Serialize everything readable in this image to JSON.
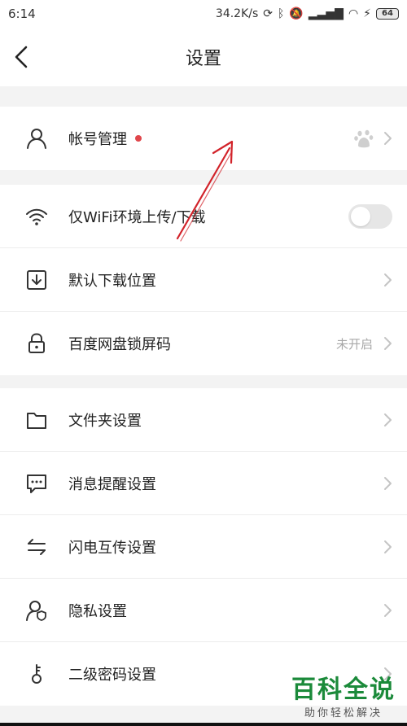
{
  "status_bar": {
    "time": "6:14",
    "net_speed": "34.2K/s",
    "battery": "64"
  },
  "header": {
    "title": "设置"
  },
  "sections": [
    {
      "rows": [
        {
          "label": "帐号管理",
          "icon": "user-icon",
          "badge_dot": true,
          "trailing": "baidu-icon"
        }
      ]
    },
    {
      "rows": [
        {
          "label": "仅WiFi环境上传/下载",
          "icon": "wifi-icon",
          "toggle_on": false
        },
        {
          "label": "默认下载位置",
          "icon": "download-icon"
        },
        {
          "label": "百度网盘锁屏码",
          "icon": "lock-icon",
          "value": "未开启"
        }
      ]
    },
    {
      "rows": [
        {
          "label": "文件夹设置",
          "icon": "folder-icon"
        },
        {
          "label": "消息提醒设置",
          "icon": "message-icon"
        },
        {
          "label": "闪电互传设置",
          "icon": "transfer-icon"
        },
        {
          "label": "隐私设置",
          "icon": "privacy-icon"
        },
        {
          "label": "二级密码设置",
          "icon": "key-icon"
        }
      ]
    }
  ],
  "watermark": {
    "title": "百科全说",
    "subtitle": "助你轻松解决"
  },
  "colors": {
    "accent_dot": "#e0464b",
    "annotation_arrow": "#d2232a",
    "watermark_green": "#1b8a3a"
  }
}
